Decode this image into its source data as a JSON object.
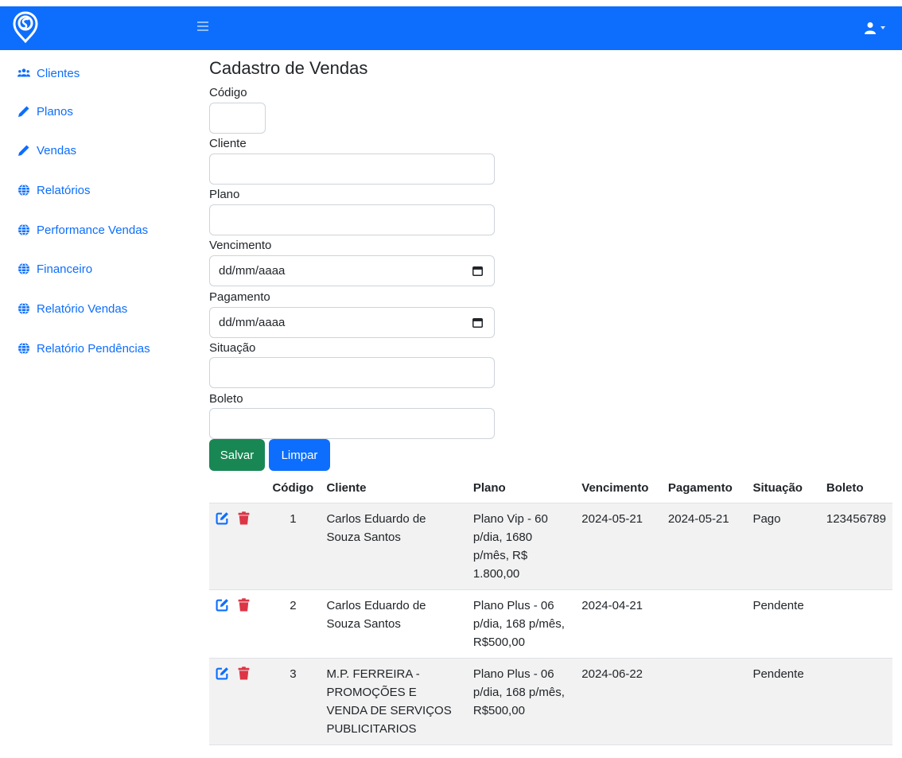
{
  "colors": {
    "primary": "#0d6efd",
    "success": "#198754",
    "danger": "#dc3545",
    "stripe": "#f2f2f2"
  },
  "header": {
    "logo_icon": "brand-logo-icon",
    "menu_icon": "hamburger-icon",
    "user_icon": "user-icon"
  },
  "sidebar": {
    "items": [
      {
        "label": "Clientes",
        "icon": "users-icon"
      },
      {
        "label": "Planos",
        "icon": "pencil-icon"
      },
      {
        "label": "Vendas",
        "icon": "pencil-icon"
      },
      {
        "label": "Relatórios",
        "icon": "globe-icon"
      },
      {
        "label": "Performance Vendas",
        "icon": "globe-icon"
      },
      {
        "label": "Financeiro",
        "icon": "globe-icon"
      },
      {
        "label": "Relatório Vendas",
        "icon": "globe-icon"
      },
      {
        "label": "Relatório Pendências",
        "icon": "globe-icon"
      }
    ]
  },
  "form": {
    "title": "Cadastro de Vendas",
    "codigo_label": "Código",
    "codigo_value": "",
    "cliente_label": "Cliente",
    "cliente_value": "",
    "plano_label": "Plano",
    "plano_value": "",
    "vencimento_label": "Vencimento",
    "vencimento_placeholder": "dd/mm/aaaa",
    "pagamento_label": "Pagamento",
    "pagamento_placeholder": "dd/mm/aaaa",
    "situacao_label": "Situação",
    "situacao_value": "",
    "boleto_label": "Boleto",
    "boleto_value": "",
    "save_label": "Salvar",
    "clear_label": "Limpar"
  },
  "table": {
    "headers": [
      "",
      "Código",
      "Cliente",
      "Plano",
      "Vencimento",
      "Pagamento",
      "Situação",
      "Boleto"
    ],
    "rows": [
      {
        "codigo": "1",
        "cliente": "Carlos Eduardo de Souza Santos",
        "plano": "Plano Vip - 60 p/dia, 1680 p/mês, R$ 1.800,00",
        "vencimento": "2024-05-21",
        "pagamento": "2024-05-21",
        "situacao": "Pago",
        "boleto": "123456789"
      },
      {
        "codigo": "2",
        "cliente": "Carlos Eduardo de Souza Santos",
        "plano": "Plano Plus - 06 p/dia, 168 p/mês, R$500,00",
        "vencimento": "2024-04-21",
        "pagamento": "",
        "situacao": "Pendente",
        "boleto": ""
      },
      {
        "codigo": "3",
        "cliente": "M.P. FERREIRA - PROMOÇÕES E VENDA DE SERVIÇOS PUBLICITARIOS",
        "plano": "Plano Plus - 06 p/dia, 168 p/mês, R$500,00",
        "vencimento": "2024-06-22",
        "pagamento": "",
        "situacao": "Pendente",
        "boleto": ""
      }
    ]
  }
}
